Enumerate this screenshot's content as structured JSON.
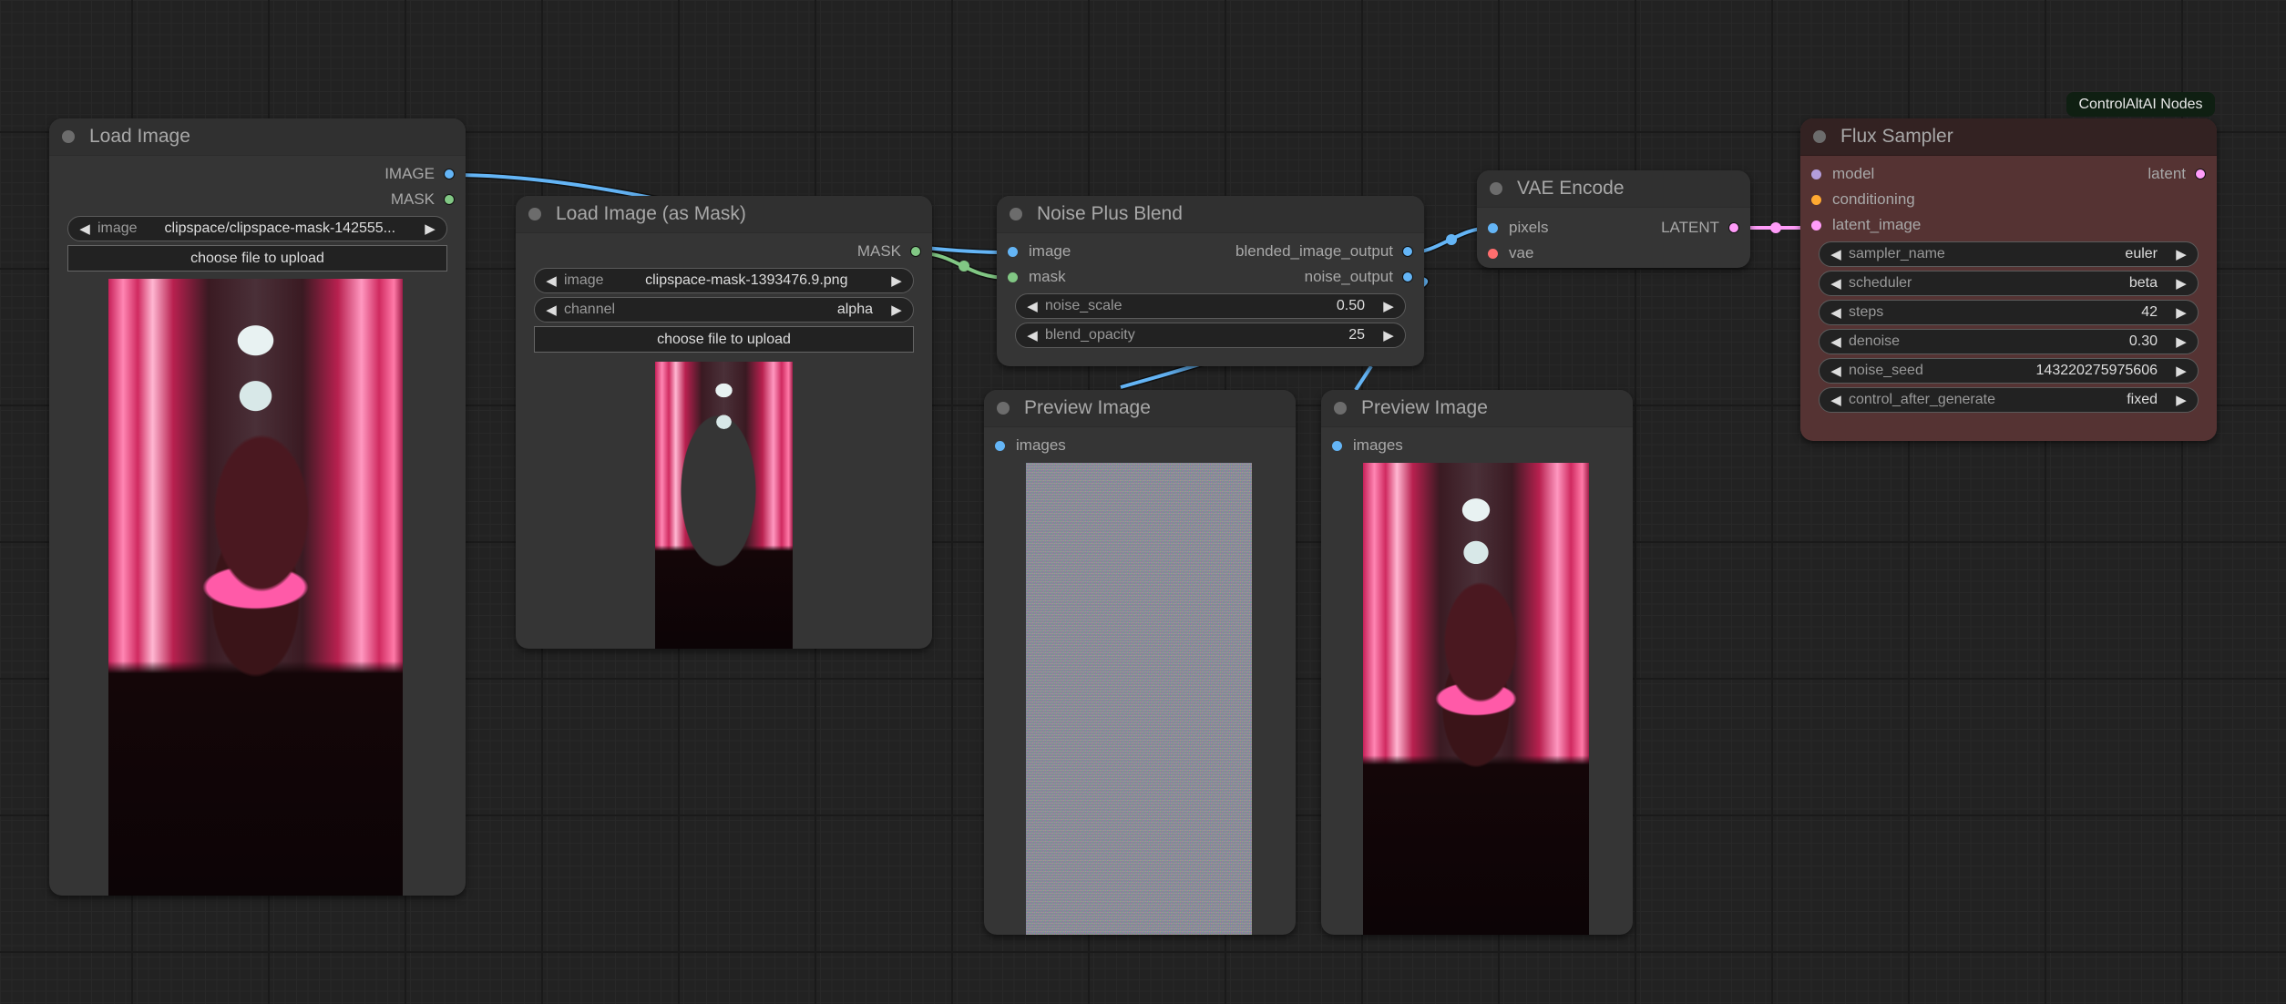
{
  "colors": {
    "image": "#64b5f6",
    "mask": "#81c784",
    "latent": "#ff9cf9",
    "vae": "#ff6e6e",
    "model": "#b39ddb",
    "conditioning": "#ffa931"
  },
  "badge": {
    "label": "ControlAltAI Nodes"
  },
  "nodes": {
    "load_image": {
      "title": "Load Image",
      "outputs": [
        {
          "label": "IMAGE",
          "type": "image"
        },
        {
          "label": "MASK",
          "type": "mask"
        }
      ],
      "widgets": [
        {
          "label": "image",
          "value": "clipspace/clipspace-mask-142555..."
        }
      ],
      "upload_label": "choose file to upload",
      "preview": "portrait-photo"
    },
    "load_image_mask": {
      "title": "Load Image (as Mask)",
      "outputs": [
        {
          "label": "MASK",
          "type": "mask"
        }
      ],
      "widgets": [
        {
          "label": "image",
          "value": "clipspace-mask-1393476.9.png"
        },
        {
          "label": "channel",
          "value": "alpha"
        }
      ],
      "upload_label": "choose file to upload",
      "preview": "masked-portrait-photo"
    },
    "noise_plus_blend": {
      "title": "Noise Plus Blend",
      "inputs": [
        {
          "label": "image",
          "type": "image"
        },
        {
          "label": "mask",
          "type": "mask"
        }
      ],
      "outputs": [
        {
          "label": "blended_image_output",
          "type": "image"
        },
        {
          "label": "noise_output",
          "type": "image"
        }
      ],
      "widgets": [
        {
          "label": "noise_scale",
          "value": "0.50"
        },
        {
          "label": "blend_opacity",
          "value": "25"
        }
      ]
    },
    "vae_encode": {
      "title": "VAE Encode",
      "inputs": [
        {
          "label": "pixels",
          "type": "image"
        },
        {
          "label": "vae",
          "type": "vae"
        }
      ],
      "outputs": [
        {
          "label": "LATENT",
          "type": "latent"
        }
      ]
    },
    "flux_sampler": {
      "title": "Flux Sampler",
      "inputs": [
        {
          "label": "model",
          "type": "model"
        },
        {
          "label": "conditioning",
          "type": "conditioning"
        },
        {
          "label": "latent_image",
          "type": "latent"
        }
      ],
      "outputs": [
        {
          "label": "latent",
          "type": "latent"
        }
      ],
      "widgets": [
        {
          "label": "sampler_name",
          "value": "euler"
        },
        {
          "label": "scheduler",
          "value": "beta"
        },
        {
          "label": "steps",
          "value": "42"
        },
        {
          "label": "denoise",
          "value": "0.30"
        },
        {
          "label": "noise_seed",
          "value": "143220275975606"
        },
        {
          "label": "control_after_generate",
          "value": "fixed"
        }
      ]
    },
    "preview_image_1": {
      "title": "Preview Image",
      "inputs": [
        {
          "label": "images",
          "type": "image"
        }
      ],
      "preview": "noise-image"
    },
    "preview_image_2": {
      "title": "Preview Image",
      "inputs": [
        {
          "label": "images",
          "type": "image"
        }
      ],
      "preview": "portrait-photo"
    }
  }
}
